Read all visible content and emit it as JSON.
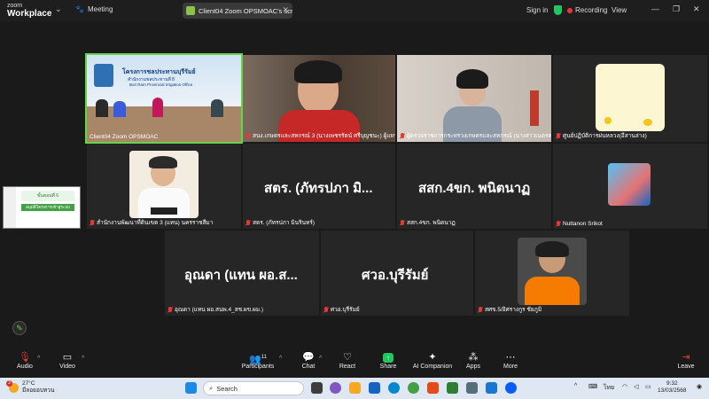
{
  "titlebar": {
    "logo_line1": "zoom",
    "logo_line2": "Workplace",
    "meeting_label": "Meeting",
    "share_title": "Client04 Zoom OPSMOAC's scree",
    "signin_label": "Sign in",
    "recording_label": "Recording",
    "view_label": "View"
  },
  "tiles": [
    {
      "label": "Client04 Zoom OPSMOAC",
      "muted": false
    },
    {
      "label": "สนง.เกษตรและสหกรณ์ 3 (นางเพชรรัตน์ ศรีบุญชนะ) ผู้แทน",
      "muted": true
    },
    {
      "label": "ผู้ตรวจราชการกระทรวงเกษตรและสหกรณ์ (นางสาวเนตรดาว สงวนวงศ์)",
      "muted": true
    },
    {
      "label": "ศูนย์ปฏิบัติการฝนหลวง(อีสานล่าง)",
      "muted": true
    },
    {
      "label": "สำนักงานพัฒนาที่ดินเขต 3 (แทน) นครราชสีมา",
      "muted": true
    },
    {
      "label": "สตร. (ภัทรปภา มินรินทร์)",
      "muted": true,
      "big": "สตร. (ภัทรปภา มิ..."
    },
    {
      "label": "สสก.4ขก. พนิตนาฏ",
      "muted": true,
      "big": "สสก.4ขก. พนิตนาฏ"
    },
    {
      "label": "Nuttanon Srikot",
      "muted": true
    },
    {
      "label": "อุณดา (แทน ผอ.สนพ.4_สช.ผข.ผม.)",
      "muted": true,
      "big": "อุณดา (แทน ผอ.ส..."
    },
    {
      "label": "ศวอ.บุรีรัมย์",
      "muted": true,
      "big": "ศวอ.บุรีรัมย์"
    },
    {
      "label": "สศข.5/อิศรางกูร ชัยภูมิ",
      "muted": true
    }
  ],
  "banner": {
    "line1": "โครงการชลประทานบุรีรัมย์",
    "line2": "สำนักงานชลประทานที่ 8",
    "line3": "Buri Ram Provincial Irrigation Office"
  },
  "thumbnail": {
    "header": "ขั้นตอนที่ 6",
    "subtext": "อนุมัติโครงการเข้าสู่ระบบ"
  },
  "toolbar": {
    "audio": "Audio",
    "video": "Video",
    "participants": "Participants",
    "participants_count": "11",
    "chat": "Chat",
    "react": "React",
    "share": "Share",
    "ai_companion": "AI Companion",
    "apps": "Apps",
    "more": "More",
    "leave": "Leave"
  },
  "taskbar": {
    "temp": "27°C",
    "weather_text": "มีลอยอบทวน",
    "badge": "3",
    "search_placeholder": "Search",
    "lang": "ไทย",
    "time": "9:32",
    "date": "13/03/2568"
  },
  "colors": {
    "active_speaker": "#6ad14b",
    "muted": "#e53935",
    "share_green": "#22c55e"
  }
}
